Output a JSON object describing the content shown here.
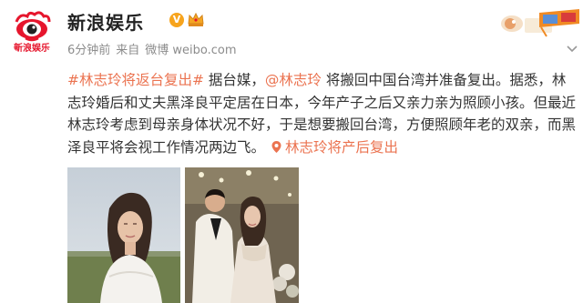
{
  "post": {
    "author": "新浪娱乐",
    "badge": "V",
    "time": "6分钟前",
    "source_prefix": "来自",
    "source": "微博 weibo.com",
    "tag1": "#林志玲将返台复出#",
    "text1": " 据台媒，",
    "mention": "@林志玲",
    "text2": " 将搬回中国台湾并准备复出。据悉，林志玲婚后和丈夫黑泽良平定居在日本，今年产子之后又亲力亲为照顾小孩。但最近林志玲考虑到母亲身体状况不好，于是想要搬回台湾，方便照顾年老的双亲，而黑泽良平将会视工作情况两边飞。",
    "tag2": "林志玲将产后复出",
    "avatar_text": "新浪娱乐"
  },
  "icons": {
    "avatar": "sina-eye-logo",
    "verified": "verified-v-icon",
    "member": "crown-icon",
    "decoration": "3d-glasses-icon",
    "link": "link-icon",
    "menu": "chevron-down-icon"
  },
  "colors": {
    "accent": "#eb7350",
    "text": "#333333",
    "meta": "#8c8c8c",
    "brand_red": "#e6162d",
    "verified": "#f7a41d"
  }
}
